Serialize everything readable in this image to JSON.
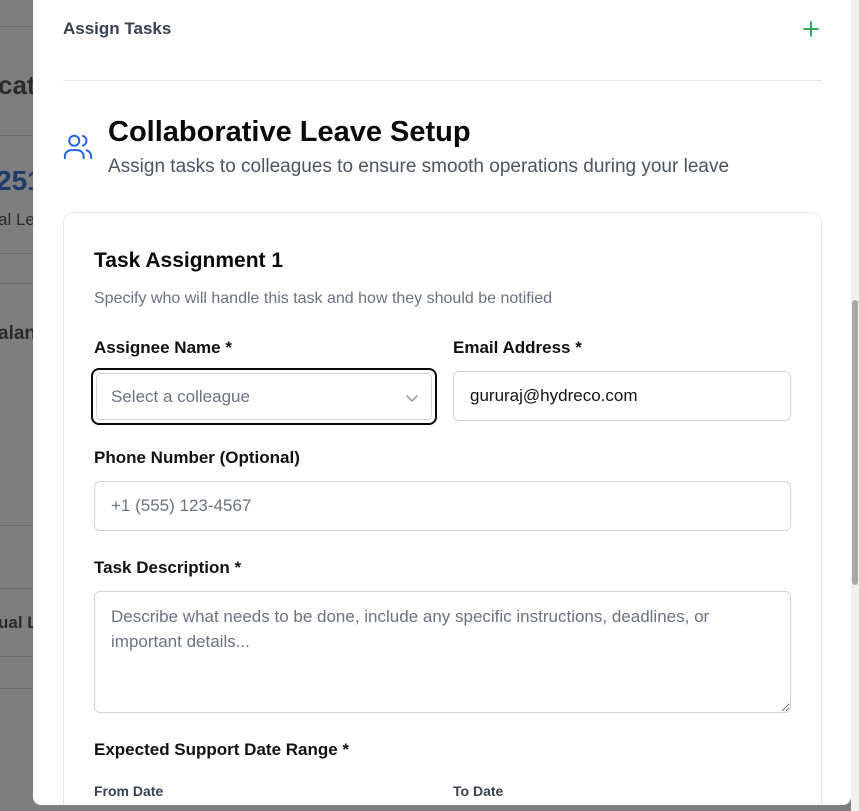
{
  "background": {
    "fragments": [
      "cat",
      "251",
      "al Le",
      "alan",
      "ual L"
    ]
  },
  "modal": {
    "assign_tasks_label": "Assign Tasks",
    "add_icon": "plus-icon",
    "header": {
      "icon": "users-icon",
      "title": "Collaborative Leave Setup",
      "subtitle": "Assign tasks to colleagues to ensure smooth operations during your leave"
    },
    "card": {
      "title": "Task Assignment 1",
      "subtitle": "Specify who will handle this task and how they should be notified",
      "assignee": {
        "label": "Assignee Name *",
        "placeholder": "Select a colleague"
      },
      "email": {
        "label": "Email Address *",
        "value": "gururaj@hydreco.com"
      },
      "phone": {
        "label": "Phone Number (Optional)",
        "placeholder": "+1 (555) 123-4567"
      },
      "description": {
        "label": "Task Description *",
        "placeholder": "Describe what needs to be done, include any specific instructions, deadlines, or important details..."
      },
      "date_range": {
        "label": "Expected Support Date Range *",
        "from_label": "From Date",
        "to_label": "To Date"
      }
    }
  },
  "colors": {
    "accent_green": "#16a34a",
    "icon_blue": "#2563eb"
  }
}
